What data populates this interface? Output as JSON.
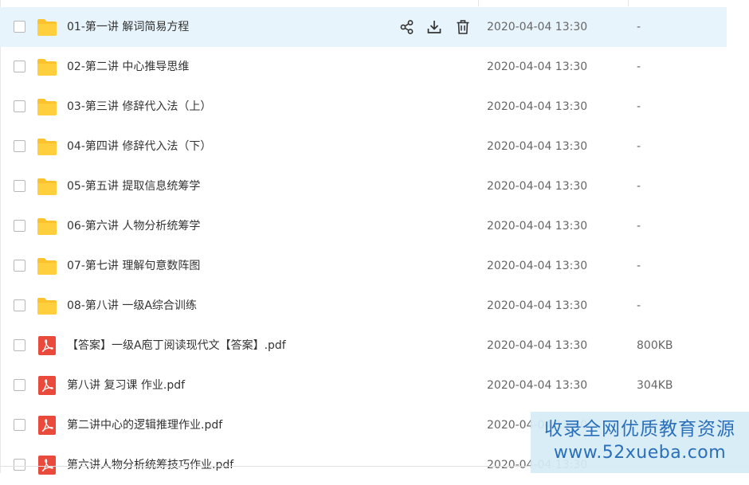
{
  "files": [
    {
      "type": "folder",
      "name": "01-第一讲 解词简易方程",
      "date": "2020-04-04 13:30",
      "size": "-",
      "hovered": true
    },
    {
      "type": "folder",
      "name": "02-第二讲 中心推导思维",
      "date": "2020-04-04 13:30",
      "size": "-"
    },
    {
      "type": "folder",
      "name": "03-第三讲 修辞代入法（上）",
      "date": "2020-04-04 13:30",
      "size": "-"
    },
    {
      "type": "folder",
      "name": "04-第四讲 修辞代入法（下）",
      "date": "2020-04-04 13:30",
      "size": "-"
    },
    {
      "type": "folder",
      "name": "05-第五讲 提取信息统筹学",
      "date": "2020-04-04 13:30",
      "size": "-"
    },
    {
      "type": "folder",
      "name": "06-第六讲 人物分析统筹学",
      "date": "2020-04-04 13:30",
      "size": "-"
    },
    {
      "type": "folder",
      "name": "07-第七讲 理解句意数阵图",
      "date": "2020-04-04 13:30",
      "size": "-"
    },
    {
      "type": "folder",
      "name": "08-第八讲 一级A综合训练",
      "date": "2020-04-04 13:30",
      "size": "-"
    },
    {
      "type": "pdf",
      "name": "【答案】一级A庖丁阅读现代文【答案】.pdf",
      "date": "2020-04-04 13:30",
      "size": "800KB"
    },
    {
      "type": "pdf",
      "name": "第八讲 复习课 作业.pdf",
      "date": "2020-04-04 13:30",
      "size": "304KB"
    },
    {
      "type": "pdf",
      "name": "第二讲中心的逻辑推理作业.pdf",
      "date": "2020-04-04 13:30",
      "size": ""
    },
    {
      "type": "pdf",
      "name": "第六讲人物分析统筹技巧作业.pdf",
      "date": "2020-04-04 13:30",
      "size": ""
    }
  ],
  "row_actions": [
    "share-icon",
    "download-icon",
    "delete-icon"
  ],
  "watermark": {
    "line1": "收录全网优质教育资源",
    "line2": "www.52xueba.com"
  },
  "colors": {
    "folder": "#fcc32c",
    "pdf": "#e94a3c",
    "hover_row": "#e8f4fc",
    "watermark_text": "#2a6fb8"
  }
}
